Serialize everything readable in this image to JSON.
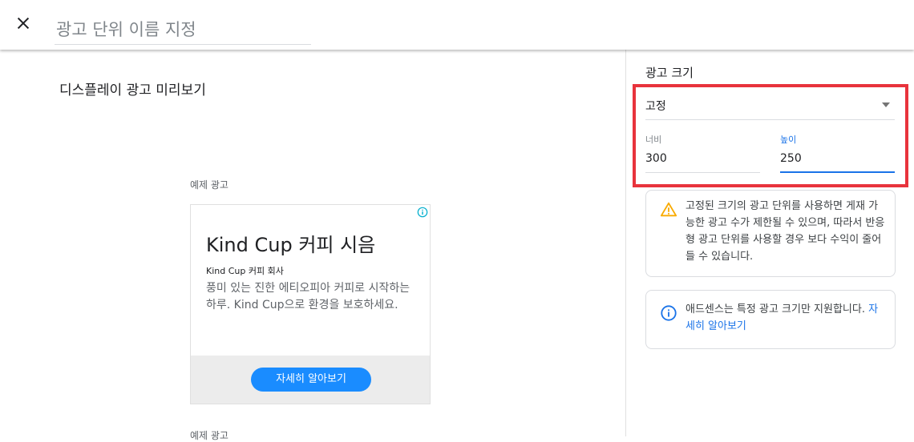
{
  "header": {
    "close_icon": "close-icon",
    "ad_unit_name_placeholder": "광고 단위 이름 지정"
  },
  "preview": {
    "title": "디스플레이 광고 미리보기",
    "sample_label": "예제 광고",
    "sample_label_second": "예제 광고",
    "ad": {
      "headline": "Kind Cup 커피 시음",
      "advertiser": "Kind Cup 커피 회사",
      "description": "풍미 있는 진한 에티오피아 커피로 시작하는 하루. Kind Cup으로 환경을 보호하세요.",
      "cta_label": "자세히 알아보기",
      "info_icon": "info-icon"
    }
  },
  "ad_size": {
    "title": "광고 크기",
    "selected_type": "고정",
    "width_label": "너비",
    "width_value": "300",
    "height_label": "높이",
    "height_value": "250"
  },
  "notices": {
    "warning_text": "고정된 크기의 광고 단위를 사용하면 게재 가능한 광고 수가 제한될 수 있으며, 따라서 반응형 광고 단위를 사용할 경우 보다 수익이 줄어들 수 있습니다.",
    "info_text": "애드센스는 특정 광고 크기만 지원합니다.",
    "info_link": "자세히 알아보기"
  },
  "colors": {
    "accent": "#1a73e8",
    "cta": "#1a8cff",
    "highlight": "#e8333c",
    "warning": "#f9ab00"
  }
}
